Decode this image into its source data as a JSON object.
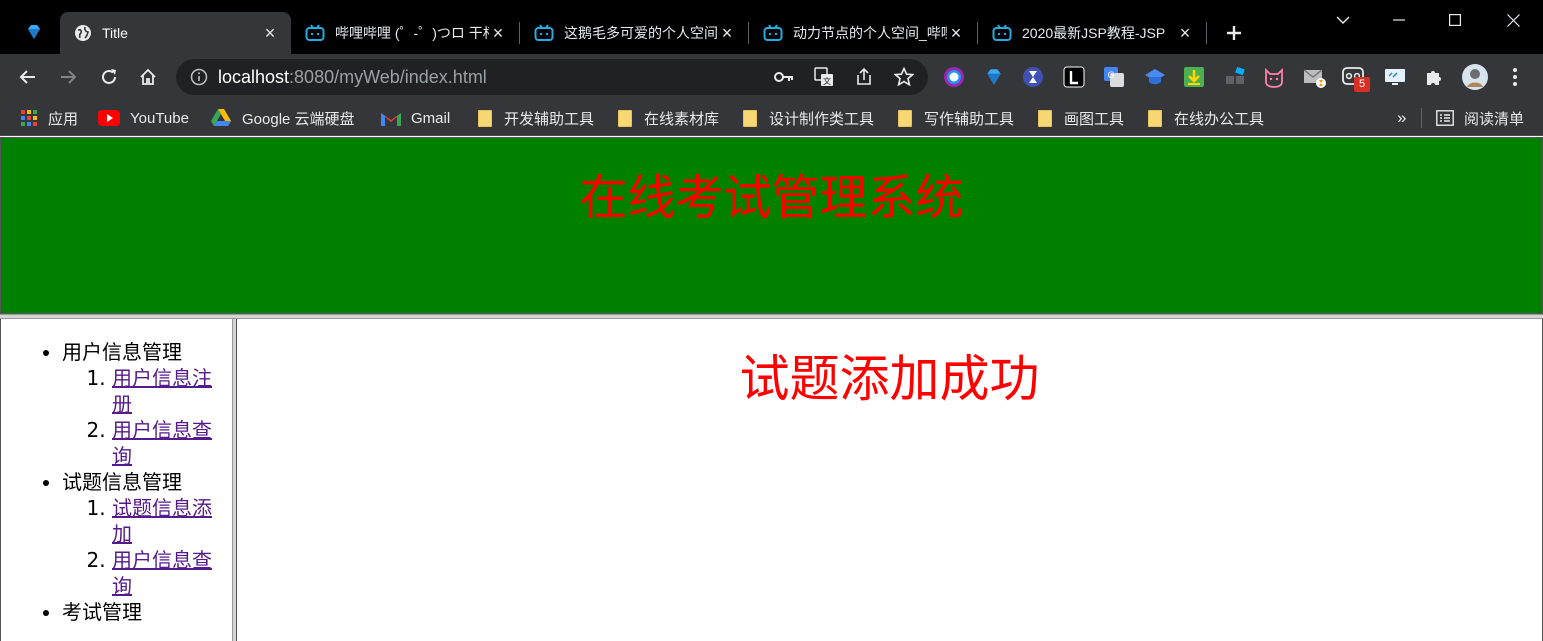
{
  "browser": {
    "tabs": [
      {
        "title": "",
        "icon": "gem-icon",
        "pinned": true
      },
      {
        "title": "Title",
        "icon": "globe-icon",
        "active": true
      },
      {
        "title": "哔哩哔哩 (゜-゜)つロ 干杯~-bilibili",
        "icon": "bilibili-icon"
      },
      {
        "title": "这鹅毛多可爱的个人空间",
        "icon": "bilibili-icon"
      },
      {
        "title": "动力节点的个人空间_哔哩",
        "icon": "bilibili-icon"
      },
      {
        "title": "2020最新JSP教程-JSP",
        "icon": "bilibili-icon"
      }
    ],
    "address": {
      "host": "localhost",
      "rest": ":8080/myWeb/index.html"
    },
    "extension_badge": "5",
    "bookmarks": [
      {
        "label": "应用",
        "icon": "apps-grid-icon"
      },
      {
        "label": "YouTube",
        "icon": "youtube-icon"
      },
      {
        "label": "Google 云端硬盘",
        "icon": "google-drive-icon"
      },
      {
        "label": "Gmail",
        "icon": "gmail-icon"
      },
      {
        "label": "开发辅助工具",
        "icon": "folder-icon"
      },
      {
        "label": "在线素材库",
        "icon": "folder-icon"
      },
      {
        "label": "设计制作类工具",
        "icon": "folder-icon"
      },
      {
        "label": "写作辅助工具",
        "icon": "folder-icon"
      },
      {
        "label": "画图工具",
        "icon": "folder-icon"
      },
      {
        "label": "在线办公工具",
        "icon": "folder-icon"
      }
    ],
    "bookmarks_overflow": "»",
    "reading_list": "阅读清单"
  },
  "page": {
    "header_title": "在线考试管理系统",
    "main_message": "试题添加成功",
    "menu": [
      {
        "label": "用户信息管理",
        "items": [
          "用户信息注册",
          "用户信息查询"
        ]
      },
      {
        "label": "试题信息管理",
        "items": [
          "试题信息添加",
          "用户信息查询"
        ]
      },
      {
        "label": "考试管理",
        "items": []
      }
    ]
  },
  "colors": {
    "header_bg": "#008000",
    "title_red": "#ff0000",
    "link_visited": "#551a8b"
  }
}
